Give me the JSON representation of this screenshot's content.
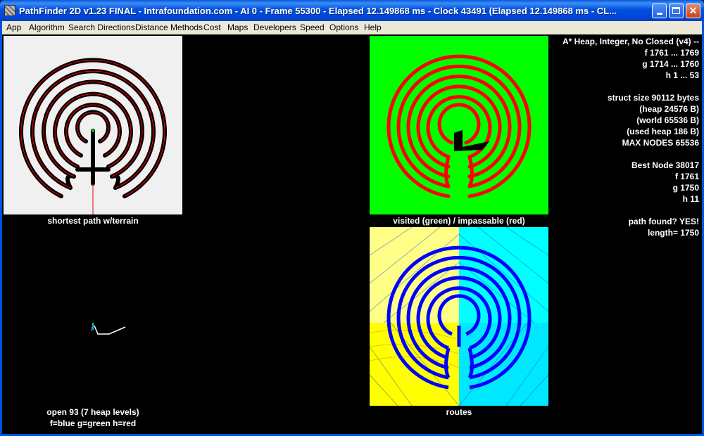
{
  "window": {
    "title": "PathFinder 2D v1.23 FINAL - Intrafoundation.com  -  AI 0  -  Frame 55300  -  Elapsed 12.149868 ms  - Clock 43491 (Elapsed 12.149868 ms - CL..."
  },
  "menu": [
    "App",
    "Algorithm",
    "Search Directions",
    "Distance Methods",
    "Cost",
    "Maps",
    "Developers",
    "Speed",
    "Options",
    "Help"
  ],
  "panels": {
    "terrain_caption": "shortest path w/terrain",
    "visited_caption": "visited (green) / impassable (red)",
    "open_caption_1": "open 93 (7 heap levels)",
    "open_caption_2": "f=blue g=green h=red",
    "routes_caption": "routes"
  },
  "stats": [
    "A* Heap, Integer, No Closed (v4) --",
    "f 1761 ... 1769",
    "g 1714 ... 1760",
    "h 1 ... 53",
    "",
    "struct size 90112 bytes",
    "(heap 24576 B)",
    "(world 65536 B)",
    "(used heap 186 B)",
    "MAX NODES 65536",
    "",
    "Best Node 38017",
    "f 1761",
    "g 1750",
    "h 11",
    "",
    "path found? YES!",
    "length= 1750"
  ],
  "colors": {
    "visited": "#00ff00",
    "impassable": "#ff0000",
    "routes_blue": "#0000ff",
    "routes_yellow": "#ffff00",
    "routes_cyan": "#00ffff"
  }
}
